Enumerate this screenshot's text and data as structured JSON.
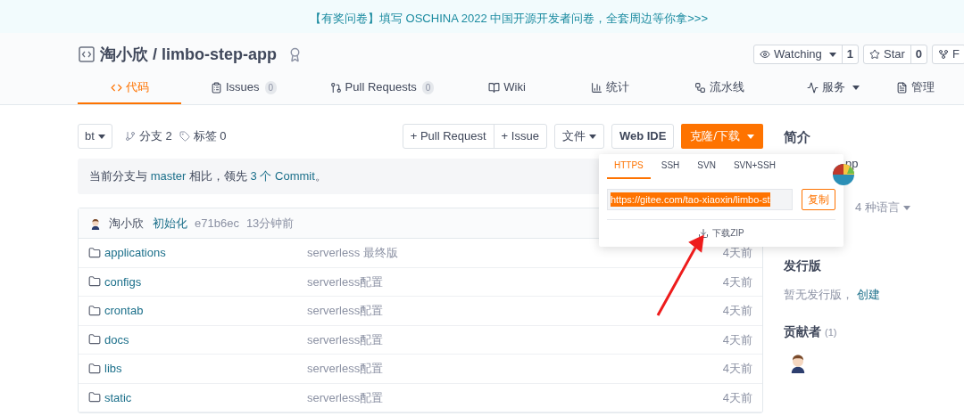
{
  "banner": {
    "text": "【有奖问卷】填写 OSCHINA 2022 中国开源开发者问卷，全套周边等你拿>>>"
  },
  "repo": {
    "owner": "淘小欣",
    "separator": "/",
    "name": "limbo-step-app"
  },
  "repo_actions": [
    {
      "label": "Watching",
      "count": "1",
      "caret": true
    },
    {
      "label": "Star",
      "count": "0",
      "caret": false
    },
    {
      "label": "F",
      "caret": false
    }
  ],
  "tabs": [
    {
      "label": "代码",
      "caret": false,
      "selected": true
    },
    {
      "label": "Issues",
      "count": "0",
      "caret": false,
      "selected": false
    },
    {
      "label": "Pull Requests",
      "count": "0",
      "caret": false,
      "selected": false
    },
    {
      "label": "Wiki",
      "caret": false,
      "selected": false
    },
    {
      "label": "统计",
      "caret": false,
      "selected": false
    },
    {
      "label": "流水线",
      "caret": false,
      "selected": false
    },
    {
      "label": "服务",
      "caret": true,
      "selected": false
    },
    {
      "label": "管理",
      "caret": false,
      "selected": false
    }
  ],
  "toolbar": {
    "branch": "bt",
    "branches": "分支 2",
    "tags": "标签 0",
    "new_pr": "+ Pull Request",
    "new_issue": "+ Issue",
    "file": "文件",
    "web_ide": "Web IDE",
    "clone": "克隆/下载"
  },
  "notice": {
    "text": "当前分支与 ",
    "link1": "master",
    "text2": " 相比，领先 ",
    "link2": "3 个 Commit",
    "text3": "。"
  },
  "commit": {
    "author": "淘小欣",
    "message": "初始化",
    "hash": "e71b6ec",
    "time": "13分钟前"
  },
  "files": [
    {
      "name": "applications",
      "message": "serverless 最终版",
      "time": "4天前"
    },
    {
      "name": "configs",
      "message": "serverless配置",
      "time": "4天前"
    },
    {
      "name": "crontab",
      "message": "serverless配置",
      "time": "4天前"
    },
    {
      "name": "docs",
      "message": "serverless配置",
      "time": "4天前"
    },
    {
      "name": "libs",
      "message": "serverless配置",
      "time": "4天前"
    },
    {
      "name": "static",
      "message": "serverless配置",
      "time": "4天前"
    }
  ],
  "clone_popup": {
    "protocols": [
      {
        "label": "HTTPS",
        "selected": true
      },
      {
        "label": "SSH",
        "selected": false
      },
      {
        "label": "SVN",
        "selected": false
      },
      {
        "label": "SVN+SSH",
        "selected": false
      }
    ],
    "url": "https://gitee.com/tao-xiaoxin/limbo-st",
    "copy": "复制",
    "download": "下载ZIP"
  },
  "sidebar": {
    "intro_title": "简介",
    "intro_text": "pp",
    "languages": "4 种语言",
    "releases_title": "发行版",
    "releases_text": "暂无发行版，",
    "releases_link": "创建",
    "contributors_title": "贡献者",
    "contributors_count": "(1)"
  }
}
